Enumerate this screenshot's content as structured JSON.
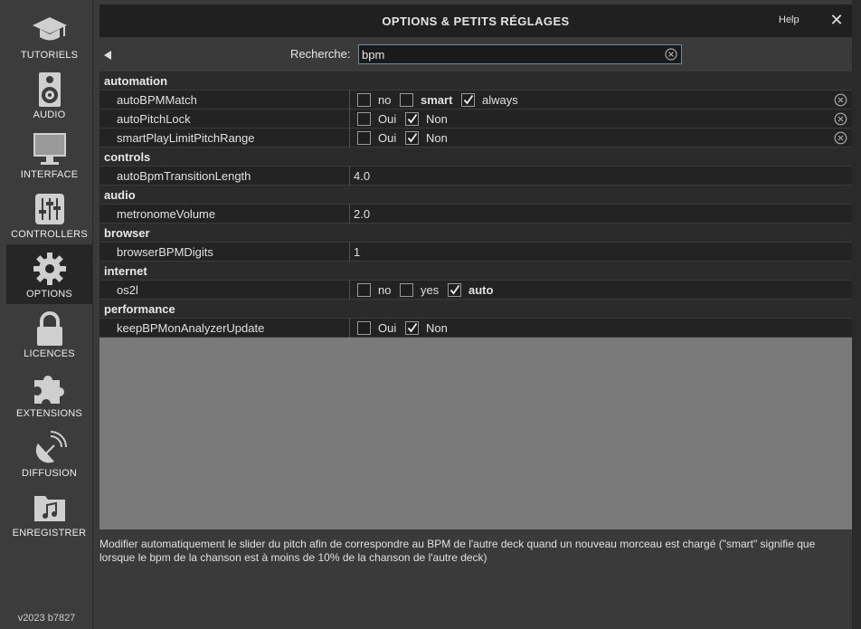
{
  "sidebar": {
    "items": [
      {
        "label": "TUTORIELS",
        "icon": "graduation-cap-icon"
      },
      {
        "label": "AUDIO",
        "icon": "speaker-icon"
      },
      {
        "label": "INTERFACE",
        "icon": "monitor-icon"
      },
      {
        "label": "CONTROLLERS",
        "icon": "sliders-icon"
      },
      {
        "label": "OPTIONS",
        "icon": "gear-icon",
        "active": true
      },
      {
        "label": "LICENCES",
        "icon": "lock-icon"
      },
      {
        "label": "EXTENSIONS",
        "icon": "puzzle-icon"
      },
      {
        "label": "DIFFUSION",
        "icon": "satellite-dish-icon"
      },
      {
        "label": "ENREGISTRER",
        "icon": "music-folder-icon"
      }
    ],
    "version": "v2023 b7827"
  },
  "header": {
    "title": "OPTIONS & PETITS RÉGLAGES",
    "help": "Help",
    "close": "✕"
  },
  "search": {
    "label": "Recherche:",
    "value": "bpm"
  },
  "categories": {
    "automation": "automation",
    "controls": "controls",
    "audio": "audio",
    "browser": "browser",
    "internet": "internet",
    "performance": "performance"
  },
  "options": {
    "autoBPMMatch": {
      "name": "autoBPMMatch",
      "choices": [
        {
          "label": "no",
          "checked": false
        },
        {
          "label": "smart",
          "checked": false
        },
        {
          "label": "always",
          "checked": true
        }
      ]
    },
    "autoPitchLock": {
      "name": "autoPitchLock",
      "choices": [
        {
          "label": "Oui",
          "checked": false
        },
        {
          "label": "Non",
          "checked": true
        }
      ]
    },
    "smartPlayLimitPitchRange": {
      "name": "smartPlayLimitPitchRange",
      "choices": [
        {
          "label": "Oui",
          "checked": false
        },
        {
          "label": "Non",
          "checked": true
        }
      ]
    },
    "autoBpmTransitionLength": {
      "name": "autoBpmTransitionLength",
      "value": "4.0"
    },
    "metronomeVolume": {
      "name": "metronomeVolume",
      "value": "2.0"
    },
    "browserBPMDigits": {
      "name": "browserBPMDigits",
      "value": "1"
    },
    "os2l": {
      "name": "os2l",
      "choices": [
        {
          "label": "no",
          "checked": false
        },
        {
          "label": "yes",
          "checked": false
        },
        {
          "label": "auto",
          "checked": true
        }
      ]
    },
    "keepBPMonAnalyzerUpdate": {
      "name": "keepBPMonAnalyzerUpdate",
      "choices": [
        {
          "label": "Oui",
          "checked": false
        },
        {
          "label": "Non",
          "checked": true
        }
      ]
    }
  },
  "description": "Modifier automatiquement le slider du pitch afin de correspondre au BPM de l'autre deck quand un nouveau morceau est chargé (\"smart\" signifie que lorsque le bpm de la chanson est à moins de 10% de la chanson de l'autre deck)",
  "colors": {
    "background": "#3a3a3a",
    "titlebar": "#202020",
    "row": "#232323",
    "empty_area": "#7a7a7a",
    "active_sidebar": "#262626"
  }
}
